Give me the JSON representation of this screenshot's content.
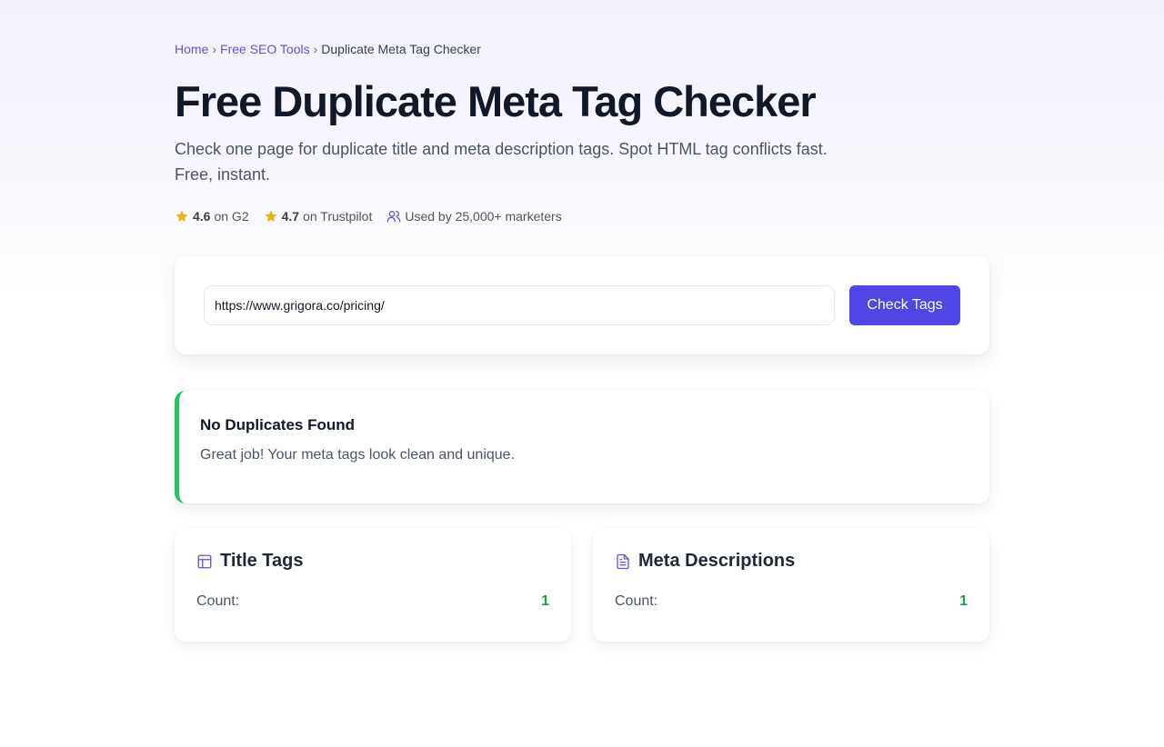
{
  "breadcrumb": {
    "home": "Home",
    "tools": "Free SEO Tools",
    "current": "Duplicate Meta Tag Checker",
    "separator": "›"
  },
  "header": {
    "title": "Free Duplicate Meta Tag Checker",
    "subtitle": "Check one page for duplicate title and meta description tags. Spot HTML tag conflicts fast. Free, instant."
  },
  "ratings": {
    "g2_score": "4.6",
    "g2_label": "on G2",
    "trustpilot_score": "4.7",
    "trustpilot_label": "on Trustpilot",
    "users_text": "Used by 25,000+ marketers"
  },
  "search": {
    "url_value": "https://www.grigora.co/pricing/",
    "button_label": "Check Tags"
  },
  "result": {
    "title": "No Duplicates Found",
    "message": "Great job! Your meta tags look clean and unique."
  },
  "stats": {
    "title_tags": {
      "heading": "Title Tags",
      "count_label": "Count:",
      "count": "1"
    },
    "meta_descriptions": {
      "heading": "Meta Descriptions",
      "count_label": "Count:",
      "count": "1"
    }
  },
  "colors": {
    "accent": "#4f46e5",
    "link": "#6d4fd1",
    "success": "#22c55e",
    "star": "#eab308"
  },
  "icons": {
    "star": "star-icon",
    "users": "users-icon",
    "layout": "layout-icon",
    "document": "document-icon"
  }
}
